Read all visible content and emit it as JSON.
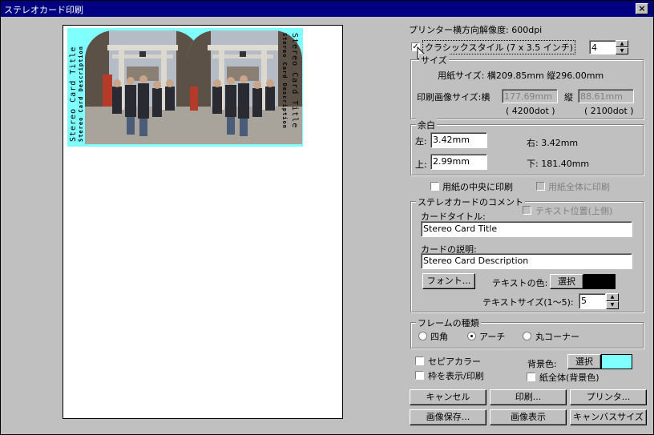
{
  "window": {
    "title": "ステレオカード印刷",
    "close_glyph": "×"
  },
  "preview": {
    "card_title": "Stereo Card Title",
    "card_description": "Stereo Card Description",
    "card_bg_color": "#80ffff"
  },
  "printer": {
    "resolution_label": "プリンター横方向解像度:",
    "resolution_value": "600dpi"
  },
  "classic_style": {
    "label": "クラシックスタイル (7 x 3.5 インチ)",
    "checked": true,
    "count": "4"
  },
  "size_group": {
    "label": "サイズ",
    "paper_size_label": "用紙サイズ:",
    "paper_size_value": "横209.85mm 縦296.00mm",
    "print_image_label": "印刷画像サイズ:横",
    "width_value": "177.69mm",
    "height_label": "縦",
    "height_value": "88.61mm",
    "width_dots": "( 4200dot )",
    "height_dots": "( 2100dot )"
  },
  "margin_group": {
    "label": "余白",
    "left_label": "左:",
    "left_value": "3.42mm",
    "right_label": "右:",
    "right_value": "3.42mm",
    "top_label": "上:",
    "top_value": "2.99mm",
    "bottom_label": "下:",
    "bottom_value": "181.40mm"
  },
  "center_print": {
    "label": "用紙の中央に印刷",
    "checked": false
  },
  "full_print": {
    "label": "用紙全体に印刷",
    "checked": false
  },
  "comment_group": {
    "label": "ステレオカードのコメント",
    "text_position_label": "テキスト位置(上側)",
    "title_label": "カードタイトル:",
    "title_value": "Stereo Card Title",
    "desc_label": "カードの説明:",
    "desc_value": "Stereo Card Description",
    "font_button": "フォント...",
    "text_color_label": "テキストの色:",
    "select_button": "選択",
    "text_color": "#000000",
    "text_size_label": "テキストサイズ(1〜5):",
    "text_size_value": "5"
  },
  "frame_group": {
    "label": "フレームの種類",
    "options": [
      "四角",
      "アーチ",
      "丸コーナー"
    ],
    "selected": "アーチ"
  },
  "sepia": {
    "label": "セピアカラー",
    "checked": false
  },
  "show_frame": {
    "label": "枠を表示/印刷",
    "checked": false
  },
  "background": {
    "label": "背景色:",
    "select_button": "選択",
    "color": "#80ffff",
    "whole_paper_label": "紙全体(背景色)",
    "whole_paper_checked": false
  },
  "buttons": {
    "cancel": "キャンセル",
    "print": "印刷...",
    "printer": "プリンタ...",
    "save_image": "画像保存...",
    "show_image": "画像表示",
    "canvas_size": "キャンバスサイズ"
  }
}
